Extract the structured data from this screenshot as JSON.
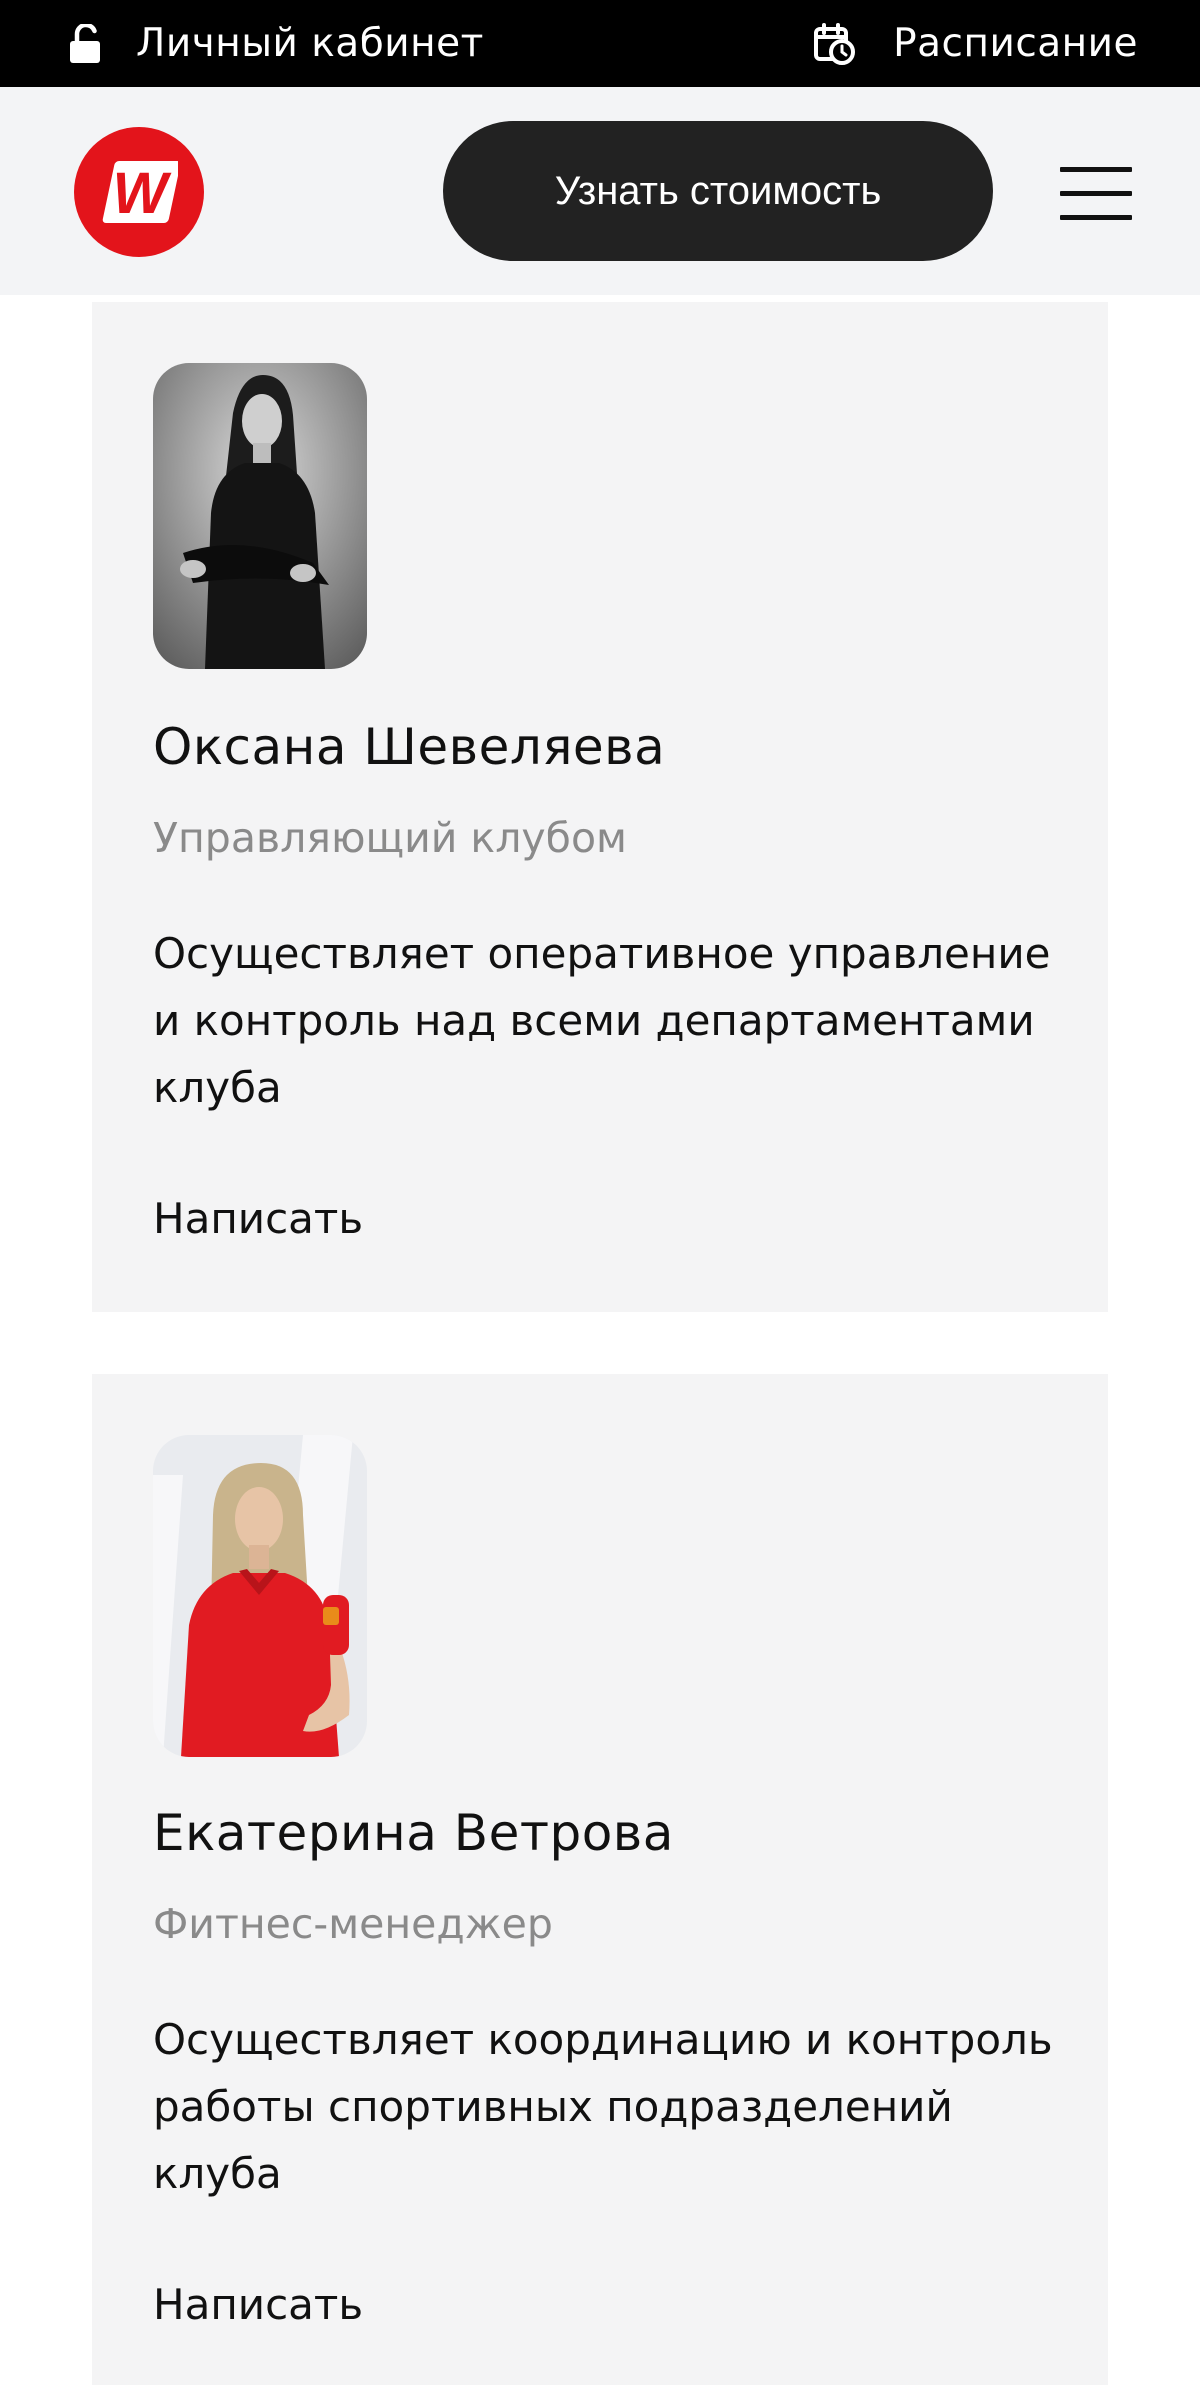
{
  "topbar": {
    "account_label": "Личный кабинет",
    "account_icon": "lock-icon",
    "schedule_label": "Расписание",
    "schedule_icon": "calendar-clock-icon"
  },
  "header": {
    "logo_letter": "W",
    "logo_icon": "brand-logo",
    "cta_label": "Узнать стоимость",
    "menu_icon": "hamburger-menu-icon"
  },
  "colors": {
    "brand_red": "#e3141b",
    "cta_dark": "#222222",
    "card_bg": "#f4f4f5",
    "muted_text": "#8a8a8a"
  },
  "staff": [
    {
      "name": "Оксана Шевеляева",
      "role": "Управляющий клубом",
      "description": "Осуществляет оперативное управление и контроль над всеми департаментами клуба",
      "contact_label": "Написать"
    },
    {
      "name": "Екатерина Ветрова",
      "role": "Фитнес-менеджер",
      "description": "Осуществляет координацию и контроль работы спортивных подразделений клуба",
      "contact_label": "Написать"
    }
  ]
}
